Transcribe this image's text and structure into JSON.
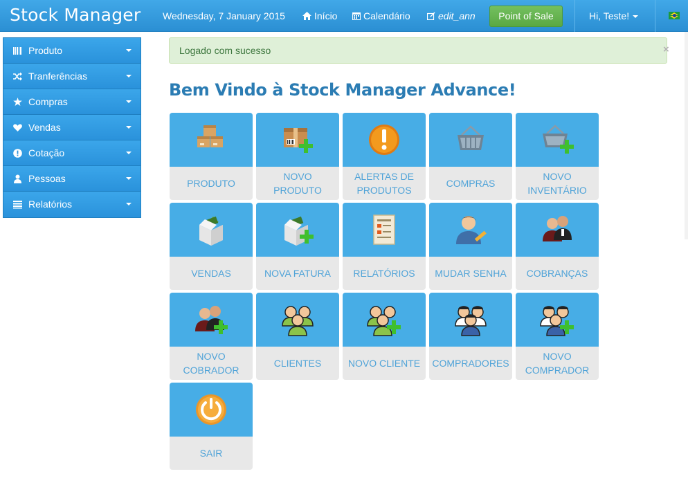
{
  "navbar": {
    "brand": "Stock Manager",
    "date": "Wednesday, 7 January 2015",
    "home": "Início",
    "calendar": "Calendário",
    "edit": "edit_ann",
    "pos": "Point of Sale",
    "user": "Hi, Teste!"
  },
  "sidebar": {
    "items": [
      {
        "label": "Produto",
        "icon": "barcode-icon"
      },
      {
        "label": "Tranferências",
        "icon": "shuffle-icon"
      },
      {
        "label": "Compras",
        "icon": "star-icon"
      },
      {
        "label": "Vendas",
        "icon": "heart-icon"
      },
      {
        "label": "Cotação",
        "icon": "exclamation-icon"
      },
      {
        "label": "Pessoas",
        "icon": "user-icon"
      },
      {
        "label": "Relatórios",
        "icon": "list-icon"
      }
    ]
  },
  "alert": {
    "message": "Logado com sucesso",
    "close": "×"
  },
  "welcome": "Bem Vindo à Stock Manager Advance!",
  "tiles": [
    {
      "label": "PRODUTO",
      "icon": "boxes-icon"
    },
    {
      "label": "NOVO PRODUTO",
      "icon": "box-add-icon"
    },
    {
      "label": "ALERTAS DE PRODUTOS",
      "icon": "alert-icon"
    },
    {
      "label": "COMPRAS",
      "icon": "basket-icon"
    },
    {
      "label": "NOVO INVENTÁRIO",
      "icon": "basket-add-icon"
    },
    {
      "label": "VENDAS",
      "icon": "sales-box-icon"
    },
    {
      "label": "NOVA FATURA",
      "icon": "sales-box-add-icon"
    },
    {
      "label": "RELATÓRIOS",
      "icon": "report-icon"
    },
    {
      "label": "MUDAR SENHA",
      "icon": "user-edit-icon"
    },
    {
      "label": "COBRANÇAS",
      "icon": "collectors-icon"
    },
    {
      "label": "NOVO COBRADOR",
      "icon": "collector-add-icon"
    },
    {
      "label": "CLIENTES",
      "icon": "clients-icon"
    },
    {
      "label": "NOVO CLIENTE",
      "icon": "client-add-icon"
    },
    {
      "label": "COMPRADORES",
      "icon": "buyers-icon"
    },
    {
      "label": "NOVO COMPRADOR",
      "icon": "buyer-add-icon"
    },
    {
      "label": "SAIR",
      "icon": "power-icon"
    }
  ]
}
